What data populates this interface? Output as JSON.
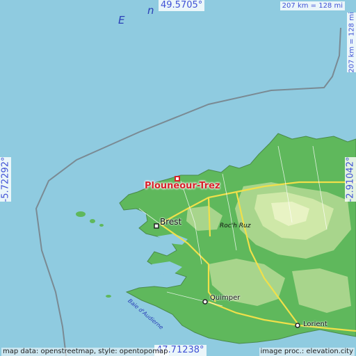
{
  "map": {
    "coords": {
      "top_lat": "49.5705°",
      "bottom_lat": "47.71238°",
      "left_lon": "-5.72292°",
      "right_lon": "-2.91042°"
    },
    "scale_top": "207 km = 128 mi",
    "scale_right": "207 km = 128 mi",
    "credit_left": "map data: openstreetmap, style: opentopomap",
    "credit_right": "image proc.: elevation.city",
    "main_place": "Plouneour-Trez",
    "places": {
      "brest": "Brest",
      "quimper": "Quimper",
      "lorient": "Lorient",
      "roc_h_ruz": "Roc'h Ruz",
      "baie": "Baie d'Audierne"
    },
    "sea_letters": [
      "E",
      "n"
    ],
    "colors": {
      "sea": "#8fcbe0",
      "land_low": "#5fb85c",
      "land_mid": "#a8d58c",
      "land_high": "#d9edb5",
      "road": "#f0e04a",
      "marker": "#d8222b",
      "coord_text": "#3f51d6"
    }
  }
}
